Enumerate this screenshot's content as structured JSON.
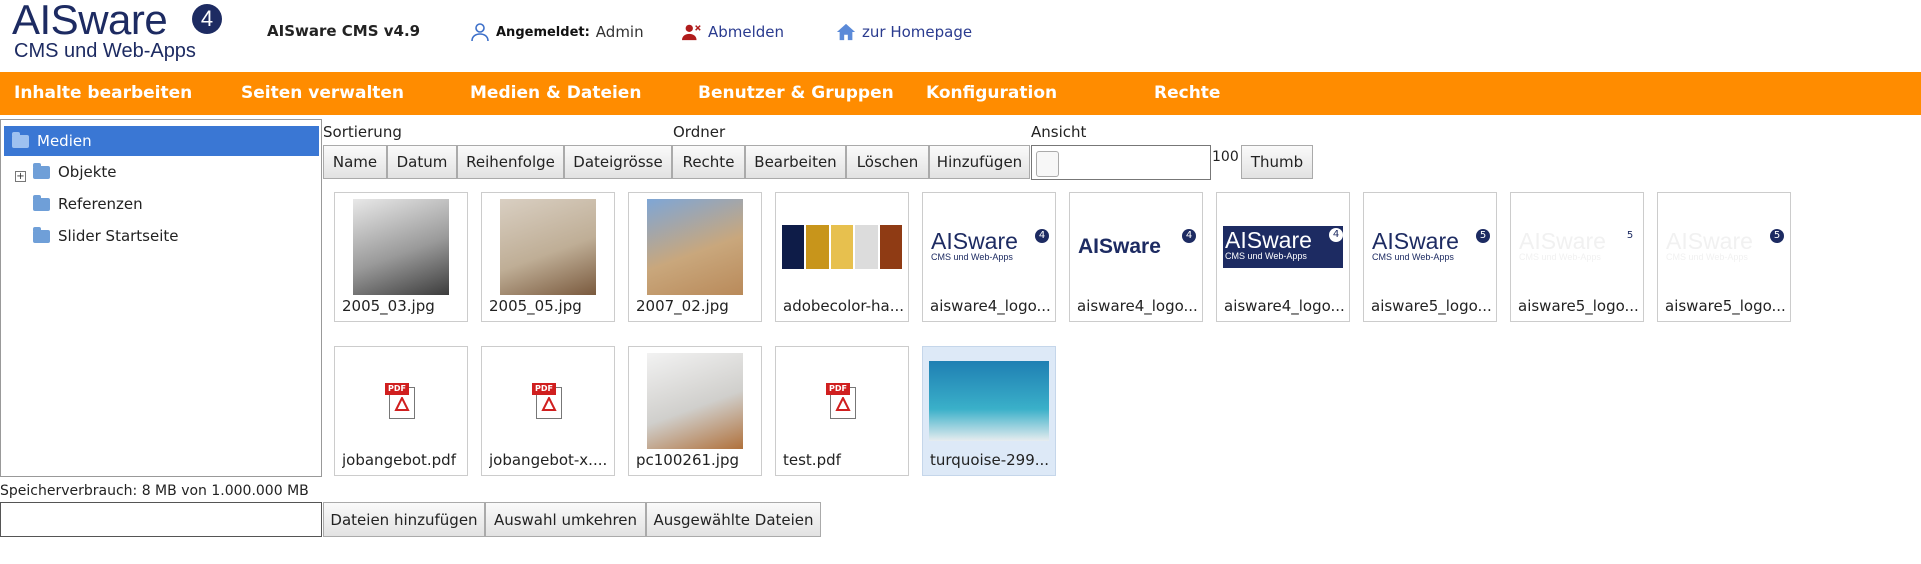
{
  "header": {
    "logo_text": "AISware",
    "logo_badge": "4",
    "logo_tagline": "CMS und Web-Apps",
    "version": "AISware CMS v4.9",
    "login_label": "Angemeldet:",
    "login_user": "Admin",
    "logout": "Abmelden",
    "home": "zur Homepage"
  },
  "nav": [
    "Inhalte bearbeiten",
    "Seiten verwalten",
    "Medien & Dateien",
    "Benutzer & Gruppen",
    "Konfiguration",
    "Rechte"
  ],
  "tree": {
    "root": "Medien",
    "items": [
      "Objekte",
      "Referenzen",
      "Slider Startseite"
    ],
    "expander": "+"
  },
  "toolbar": {
    "sort_label": "Sortierung",
    "folder_label": "Ordner",
    "view_label": "Ansicht",
    "sort_buttons": [
      "Name",
      "Datum",
      "Reihenfolge",
      "Dateigrösse"
    ],
    "folder_buttons": [
      "Rechte",
      "Bearbeiten",
      "Löschen",
      "Hinzufügen"
    ],
    "thumb_size": "100",
    "view_button": "Thumb"
  },
  "files": [
    {
      "name": "2005_03.jpg",
      "type": "photo",
      "colors": [
        "#e8e8e8",
        "#3c3c3c",
        "#9a9a9a"
      ]
    },
    {
      "name": "2005_05.jpg",
      "type": "photo",
      "colors": [
        "#d9cfc2",
        "#7a5a3e",
        "#bfae96"
      ]
    },
    {
      "name": "2007_02.jpg",
      "type": "photo",
      "colors": [
        "#7ea6d6",
        "#b98a5a",
        "#c9a77c"
      ]
    },
    {
      "name": "adobecolor-ha...",
      "type": "swatch",
      "colors": [
        "#0e1c48",
        "#c8951b",
        "#e7c04e",
        "#dcdcdc",
        "#8f3b14"
      ]
    },
    {
      "name": "aisware4_logo...",
      "type": "logo",
      "variant": "blue4"
    },
    {
      "name": "aisware4_logo...",
      "type": "logo",
      "variant": "bold4"
    },
    {
      "name": "aisware4_logo...",
      "type": "logo",
      "variant": "inverse4"
    },
    {
      "name": "aisware5_logo...",
      "type": "logo",
      "variant": "blue5"
    },
    {
      "name": "aisware5_logo...",
      "type": "logo",
      "variant": "white5"
    },
    {
      "name": "aisware5_logo...",
      "type": "logo",
      "variant": "white5dark"
    },
    {
      "name": "jobangebot.pdf",
      "type": "pdf"
    },
    {
      "name": "jobangebot-x....",
      "type": "pdf"
    },
    {
      "name": "pc100261.jpg",
      "type": "photo",
      "colors": [
        "#f2f2f2",
        "#b0713c",
        "#d0cfcc"
      ]
    },
    {
      "name": "test.pdf",
      "type": "pdf"
    },
    {
      "name": "turquoise-299...",
      "type": "sea",
      "selected": true
    }
  ],
  "footer": {
    "storage": "Speicherverbrauch: 8 MB von 1.000.000 MB",
    "buttons": [
      "Dateien hinzufügen",
      "Auswahl umkehren",
      "Ausgewählte Dateien"
    ]
  }
}
